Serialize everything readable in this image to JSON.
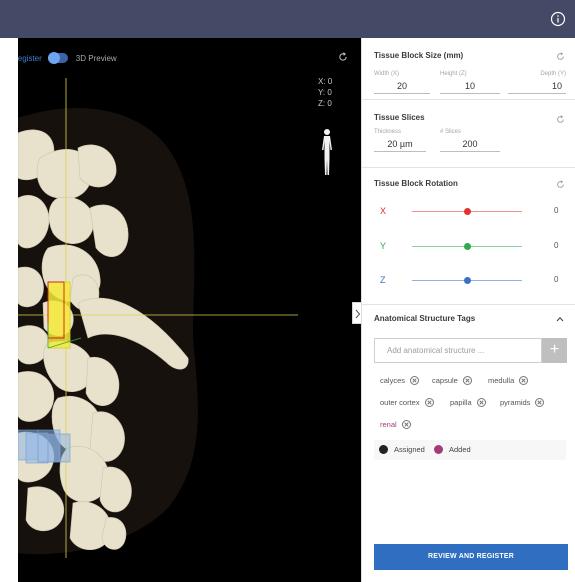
{
  "viewer": {
    "register_label": "Register",
    "preview_label": "3D Preview",
    "coords": {
      "x": "X: 0",
      "y": "Y: 0",
      "z": "Z: 0"
    }
  },
  "panel": {
    "block_size": {
      "title": "Tissue Block Size  (mm)",
      "width_label": "Width (X)",
      "width_value": "20",
      "height_label": "Height (Z)",
      "height_value": "10",
      "depth_label": "Depth (Y)",
      "depth_value": "10"
    },
    "slices": {
      "title": "Tissue Slices",
      "thickness_label": "Thickness",
      "thickness_value": "20 µm",
      "count_label": "# Slices",
      "count_value": "200"
    },
    "rotation": {
      "title": "Tissue Block Rotation",
      "axes": [
        {
          "label": "X",
          "value": "0",
          "color": "#e03131",
          "position": 0.5
        },
        {
          "label": "Y",
          "value": "0",
          "color": "#2fa84f",
          "position": 0.5
        },
        {
          "label": "Z",
          "value": "0",
          "color": "#3d6fc6",
          "position": 0.5
        }
      ]
    },
    "tags": {
      "title": "Anatomical Structure Tags",
      "input_placeholder": "Add anatomical structure ...",
      "add_symbol": "+",
      "items": [
        "calyces",
        "capsule",
        "medulla",
        "outer cortex",
        "papilla",
        "pyramids",
        "renal"
      ],
      "added_color": "#a33b78",
      "assigned_color": "#222222"
    },
    "legend": {
      "assigned": "Assigned",
      "added": "Added"
    },
    "register_button": "REVIEW AND REGISTER"
  },
  "colors": {
    "topbar": "#444a65",
    "accent": "#2f6ec1",
    "tissue": "#e8e1cb"
  }
}
